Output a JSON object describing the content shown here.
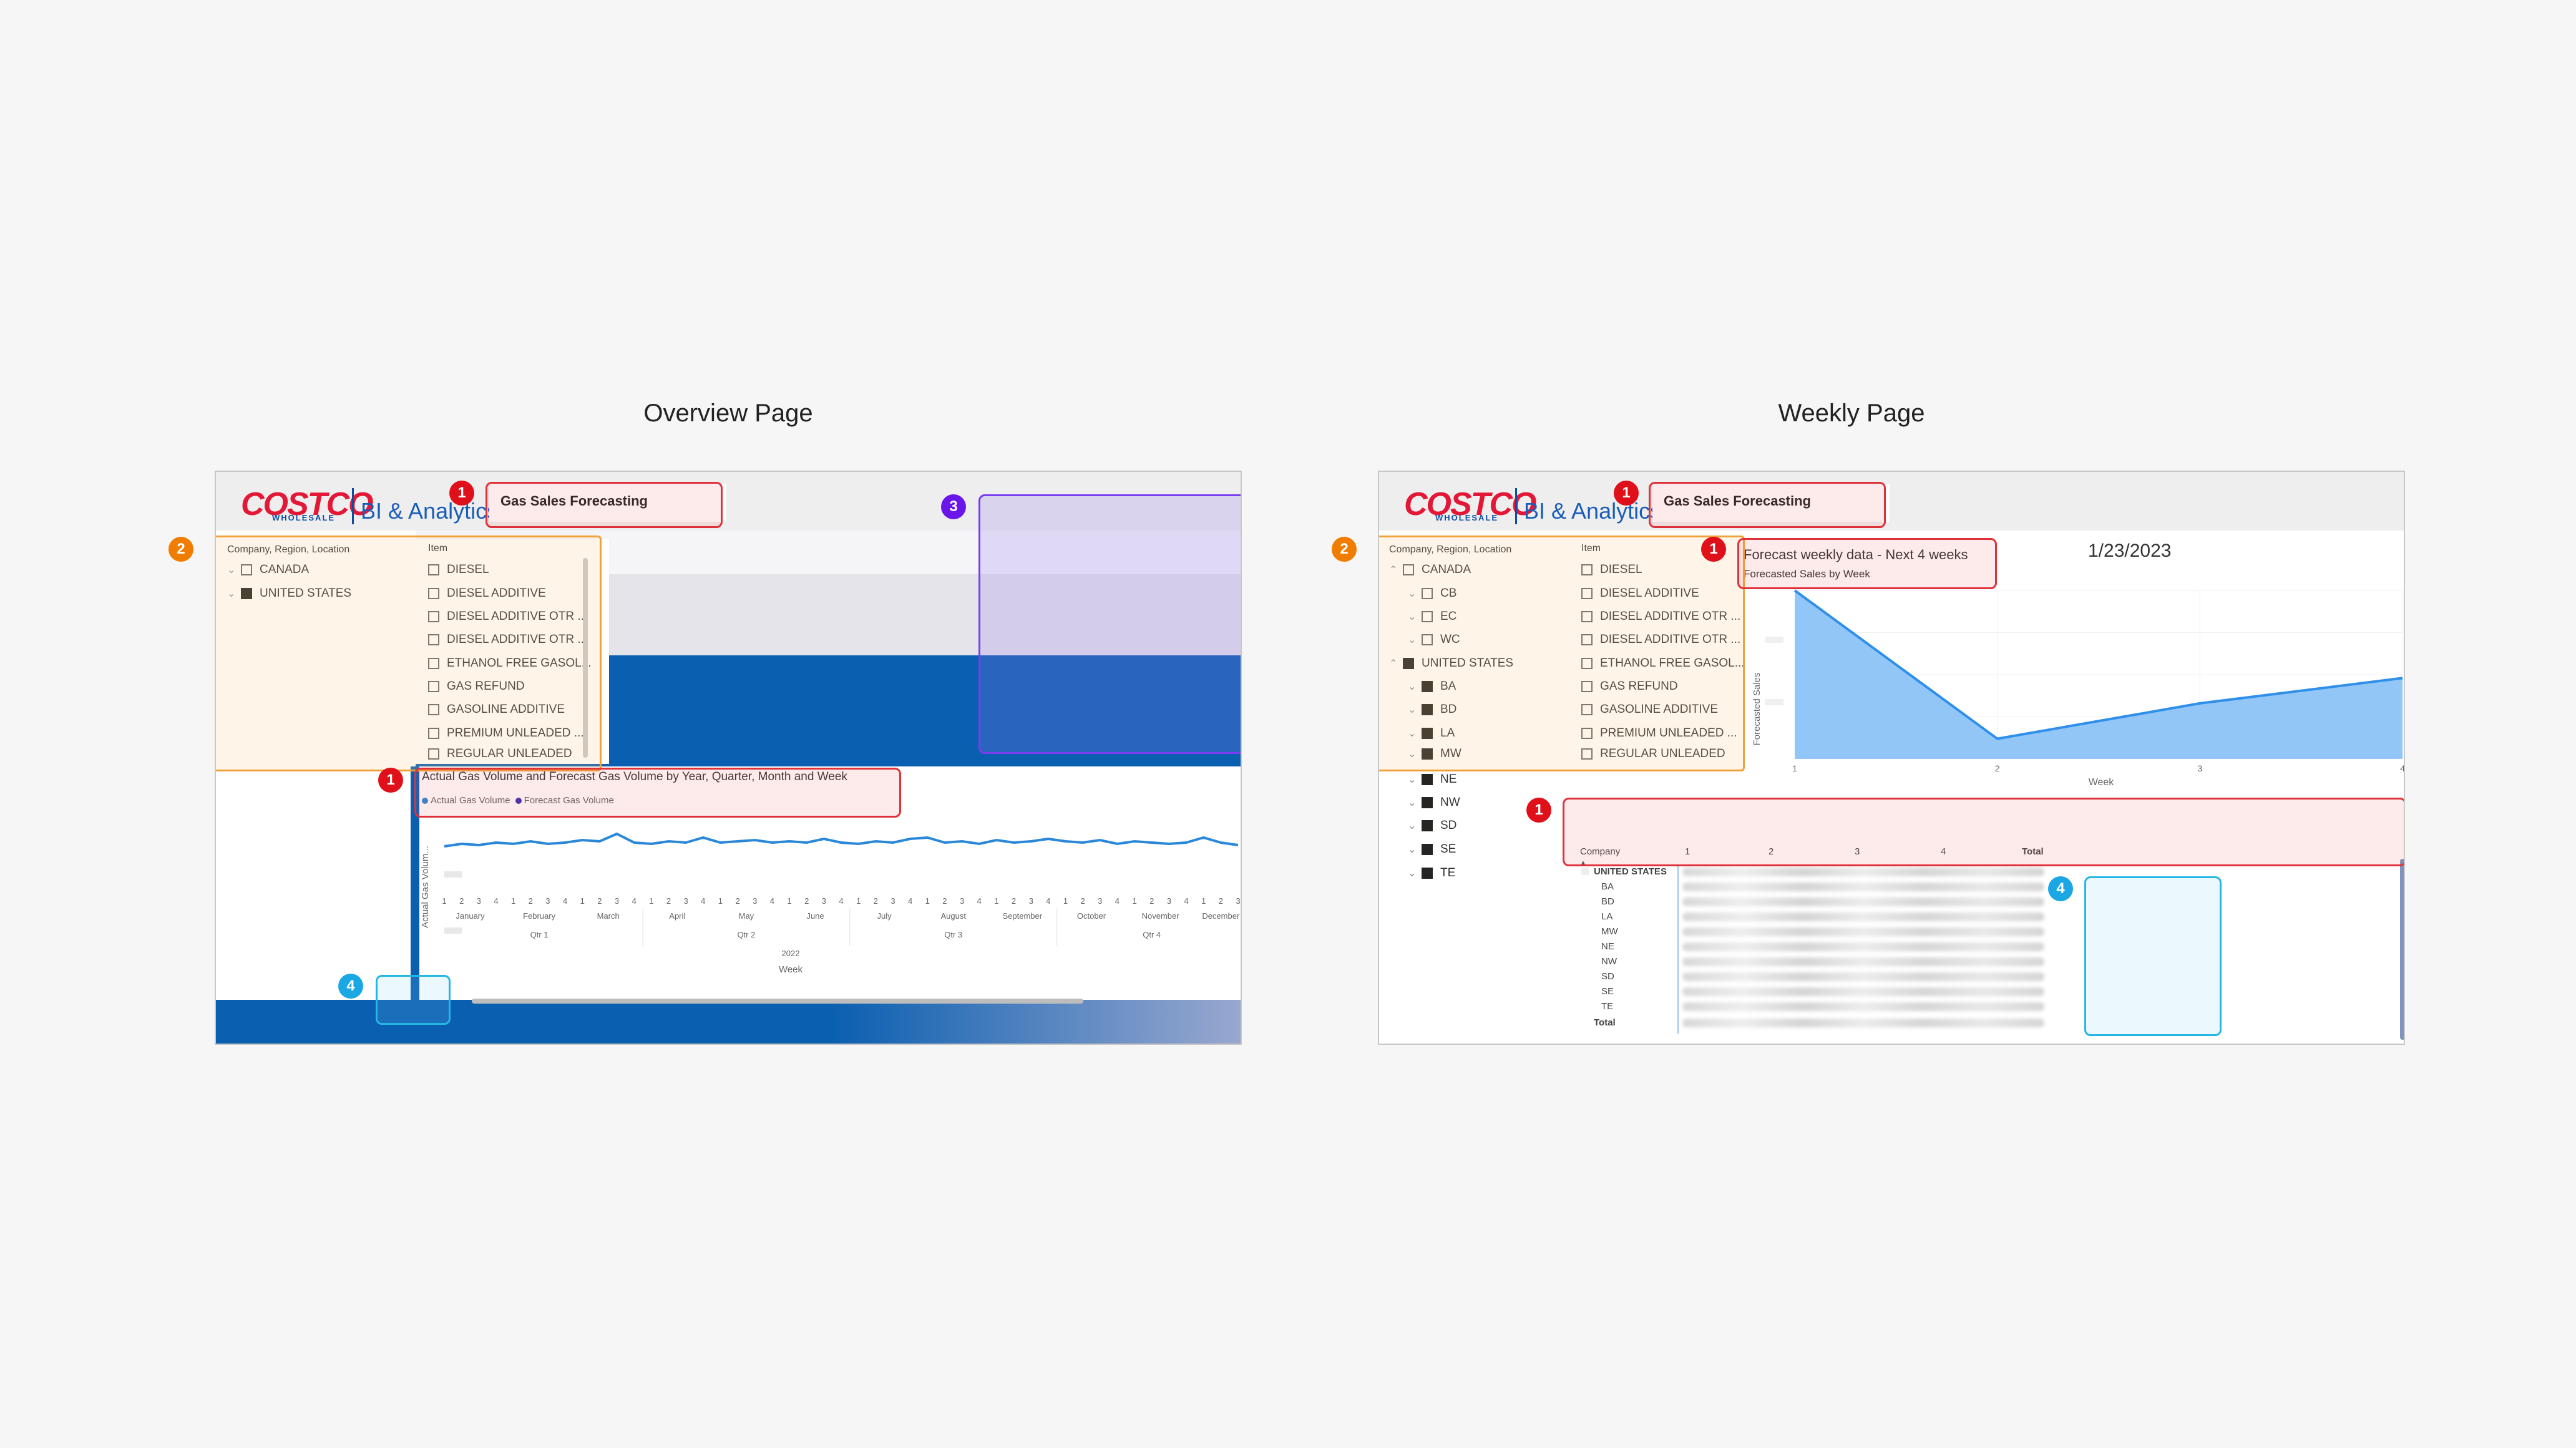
{
  "headings": {
    "left": "Overview Page",
    "right": "Weekly Page"
  },
  "brand": {
    "logo_text": "COSTCO",
    "logo_sub": "WHOLESALE",
    "bi_text": "BI & Analytics",
    "red": "#e31837",
    "blue": "#0d4ea3"
  },
  "badges": {
    "one": "1",
    "two": "2",
    "three": "3",
    "four": "4"
  },
  "overview": {
    "title": "Gas Sales Forecasting",
    "slicer_company": {
      "header": "Company, Region, Location",
      "items": [
        "CANADA",
        "UNITED STATES"
      ]
    },
    "slicer_item": {
      "header": "Item",
      "items": [
        "DIESEL",
        "DIESEL ADDITIVE",
        "DIESEL ADDITIVE OTR ...",
        "DIESEL ADDITIVE OTR ...",
        "ETHANOL FREE GASOL...",
        "GAS REFUND",
        "GASOLINE ADDITIVE",
        "PREMIUM UNLEADED ...",
        "REGULAR UNLEADED"
      ]
    },
    "chart_title": "Actual Gas Volume and Forecast Gas Volume by Year, Quarter, Month and Week",
    "legend": [
      "Actual Gas Volume",
      "Forecast Gas Volume"
    ],
    "ylabel": "Actual Gas Volum...",
    "xlabel": "Week",
    "months": [
      "January",
      "February",
      "March",
      "April",
      "May",
      "June",
      "July",
      "August",
      "September",
      "October",
      "November",
      "December"
    ],
    "quarters": [
      "Qtr 1",
      "Qtr 2",
      "Qtr 3",
      "Qtr 4"
    ],
    "year": "2022"
  },
  "weekly": {
    "title": "Gas Sales Forecasting",
    "date": "1/23/2023",
    "slicer_company": {
      "header": "Company, Region, Location",
      "canada": "CANADA",
      "canada_children": [
        "CB",
        "EC",
        "WC"
      ],
      "us": "UNITED STATES",
      "us_children": [
        "BA",
        "BD",
        "LA",
        "MW",
        "NE",
        "NW",
        "SD",
        "SE",
        "TE"
      ]
    },
    "slicer_item": {
      "header": "Item",
      "items": [
        "DIESEL",
        "DIESEL ADDITIVE",
        "DIESEL ADDITIVE OTR ...",
        "DIESEL ADDITIVE OTR ...",
        "ETHANOL FREE GASOL...",
        "GAS REFUND",
        "GASOLINE ADDITIVE",
        "PREMIUM UNLEADED ...",
        "REGULAR UNLEADED"
      ]
    },
    "chart_heading": "Forecast weekly data - Next 4 weeks",
    "chart_subtitle": "Forecasted Sales by Week",
    "table": {
      "headers": [
        "Company",
        "1",
        "2",
        "3",
        "4",
        "Total"
      ],
      "group": "UNITED STATES",
      "rows": [
        "BA",
        "BD",
        "LA",
        "MW",
        "NE",
        "NW",
        "SD",
        "SE",
        "TE"
      ],
      "total": "Total"
    }
  },
  "chart_data": [
    {
      "type": "line",
      "title": "Actual Gas Volume and Forecast Gas Volume by Year, Quarter, Month and Week",
      "xlabel": "Week",
      "ylabel": "Actual Gas Volum...",
      "x_tick_labels": [
        "1",
        "2",
        "3",
        "4",
        "1",
        "2",
        "3",
        "4",
        "1",
        "2",
        "3",
        "4",
        "1",
        "2",
        "3",
        "4",
        "1",
        "2",
        "3",
        "4",
        "1",
        "2",
        "3",
        "4",
        "1",
        "2",
        "3",
        "4",
        "1",
        "2",
        "3",
        "4",
        "1",
        "2",
        "3",
        "4",
        "1",
        "2",
        "3",
        "4",
        "1",
        "2",
        "3",
        "4",
        "1",
        "2",
        "3"
      ],
      "series": [
        {
          "name": "Actual Gas Volume",
          "color": "#2b88d8",
          "values": [
            0.3,
            0.32,
            0.31,
            0.33,
            0.32,
            0.34,
            0.32,
            0.33,
            0.35,
            0.34,
            0.4,
            0.33,
            0.32,
            0.34,
            0.33,
            0.37,
            0.33,
            0.34,
            0.35,
            0.33,
            0.34,
            0.33,
            0.36,
            0.33,
            0.32,
            0.34,
            0.33,
            0.36,
            0.37,
            0.33,
            0.34,
            0.32,
            0.35,
            0.33,
            0.34,
            0.36,
            0.34,
            0.33,
            0.35,
            0.32,
            0.34,
            0.33,
            0.32,
            0.33,
            0.37,
            0.33,
            0.31
          ]
        },
        {
          "name": "Forecast Gas Volume",
          "color": "#3b2fb3",
          "values": []
        }
      ],
      "grid": false,
      "legend": "top-left"
    },
    {
      "type": "area",
      "title": "Forecasted Sales by Week",
      "xlabel": "Week",
      "ylabel": "Forecasted Sales",
      "x": [
        1,
        2,
        3,
        4
      ],
      "series": [
        {
          "name": "Forecasted Sales",
          "color": "#56a8f5",
          "values": [
            1.0,
            0.12,
            0.33,
            0.48
          ]
        }
      ],
      "grid": true
    }
  ]
}
